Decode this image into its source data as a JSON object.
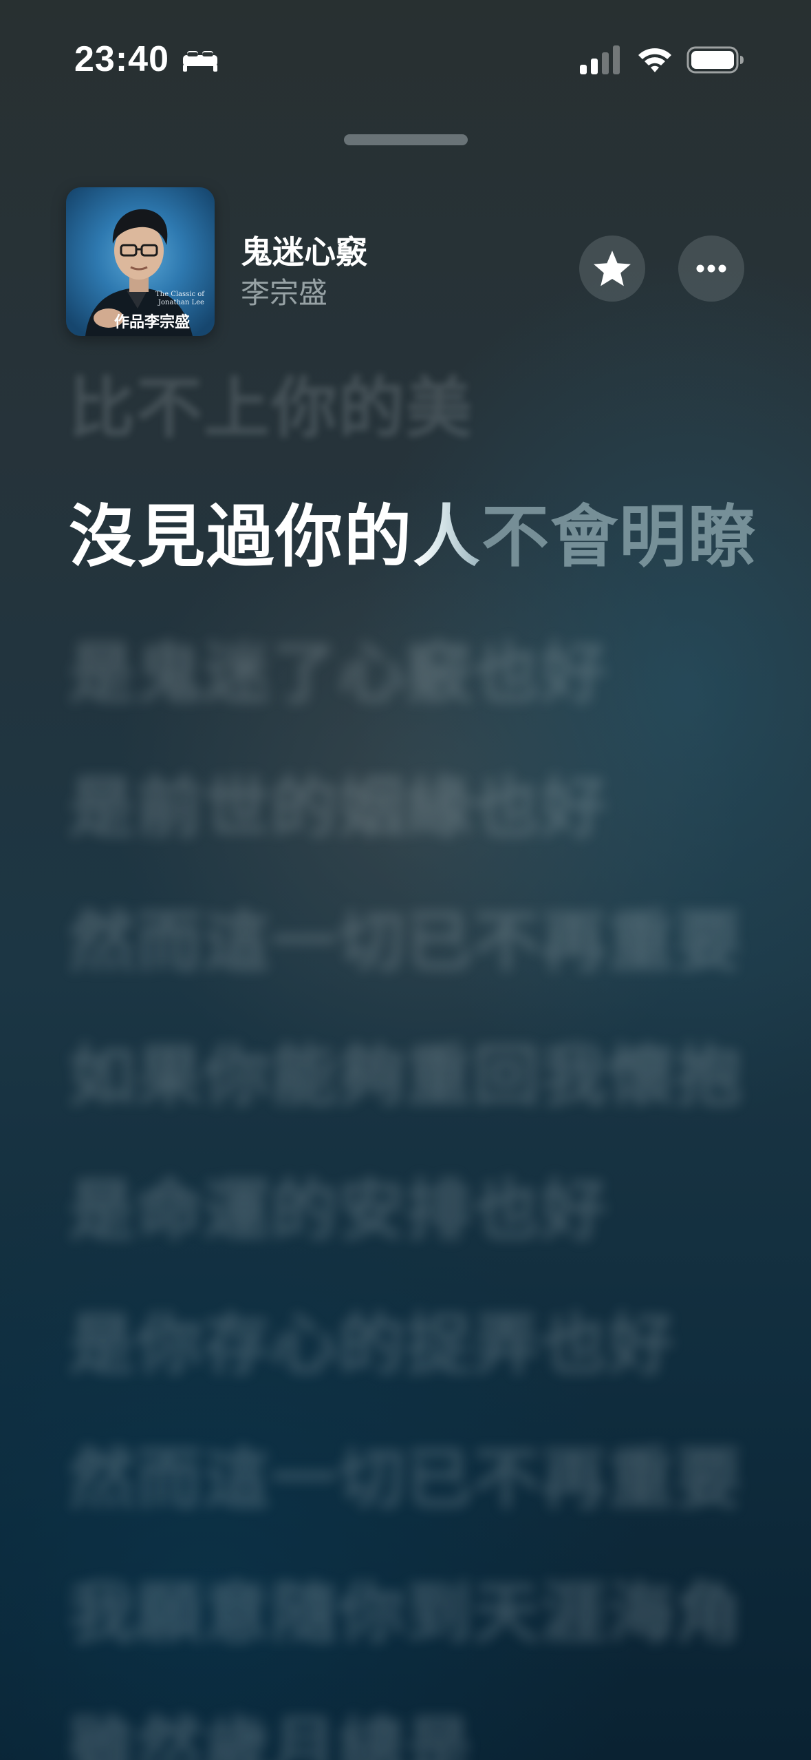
{
  "status_bar": {
    "time": "23:40",
    "focus_icon": "bed-icon",
    "signal_icon": "cellular-signal-icon",
    "wifi_icon": "wifi-icon",
    "battery_icon": "battery-icon"
  },
  "now_playing": {
    "title": "鬼迷心竅",
    "artist": "李宗盛",
    "artwork": {
      "caption": "作品李宗盛",
      "small_text_line1": "The Classic of",
      "small_text_line2": "Jonathan Lee"
    },
    "favorite_icon": "star-icon",
    "more_icon": "ellipsis-icon"
  },
  "lyrics": {
    "previous": "比不上你的美",
    "current": {
      "sung": "沒見過你的",
      "in_progress": "人",
      "upcoming": "不會明瞭"
    },
    "upcoming": [
      "是鬼迷了心竅也好",
      "是前世的姻緣也好",
      "然而這一切已不再重要",
      "如果你能夠重回我懷抱",
      "是命運的安排也好",
      "是你存心的捉弄也好",
      "然而這一切已不再重要",
      "我願意隨你到天涯海角",
      "雖然歲月總是"
    ]
  },
  "colors": {
    "background_top": "#283031",
    "background_bottom": "#0a2232",
    "artwork_blue": "#2e79b0",
    "lyric_active": "#ffffff"
  }
}
